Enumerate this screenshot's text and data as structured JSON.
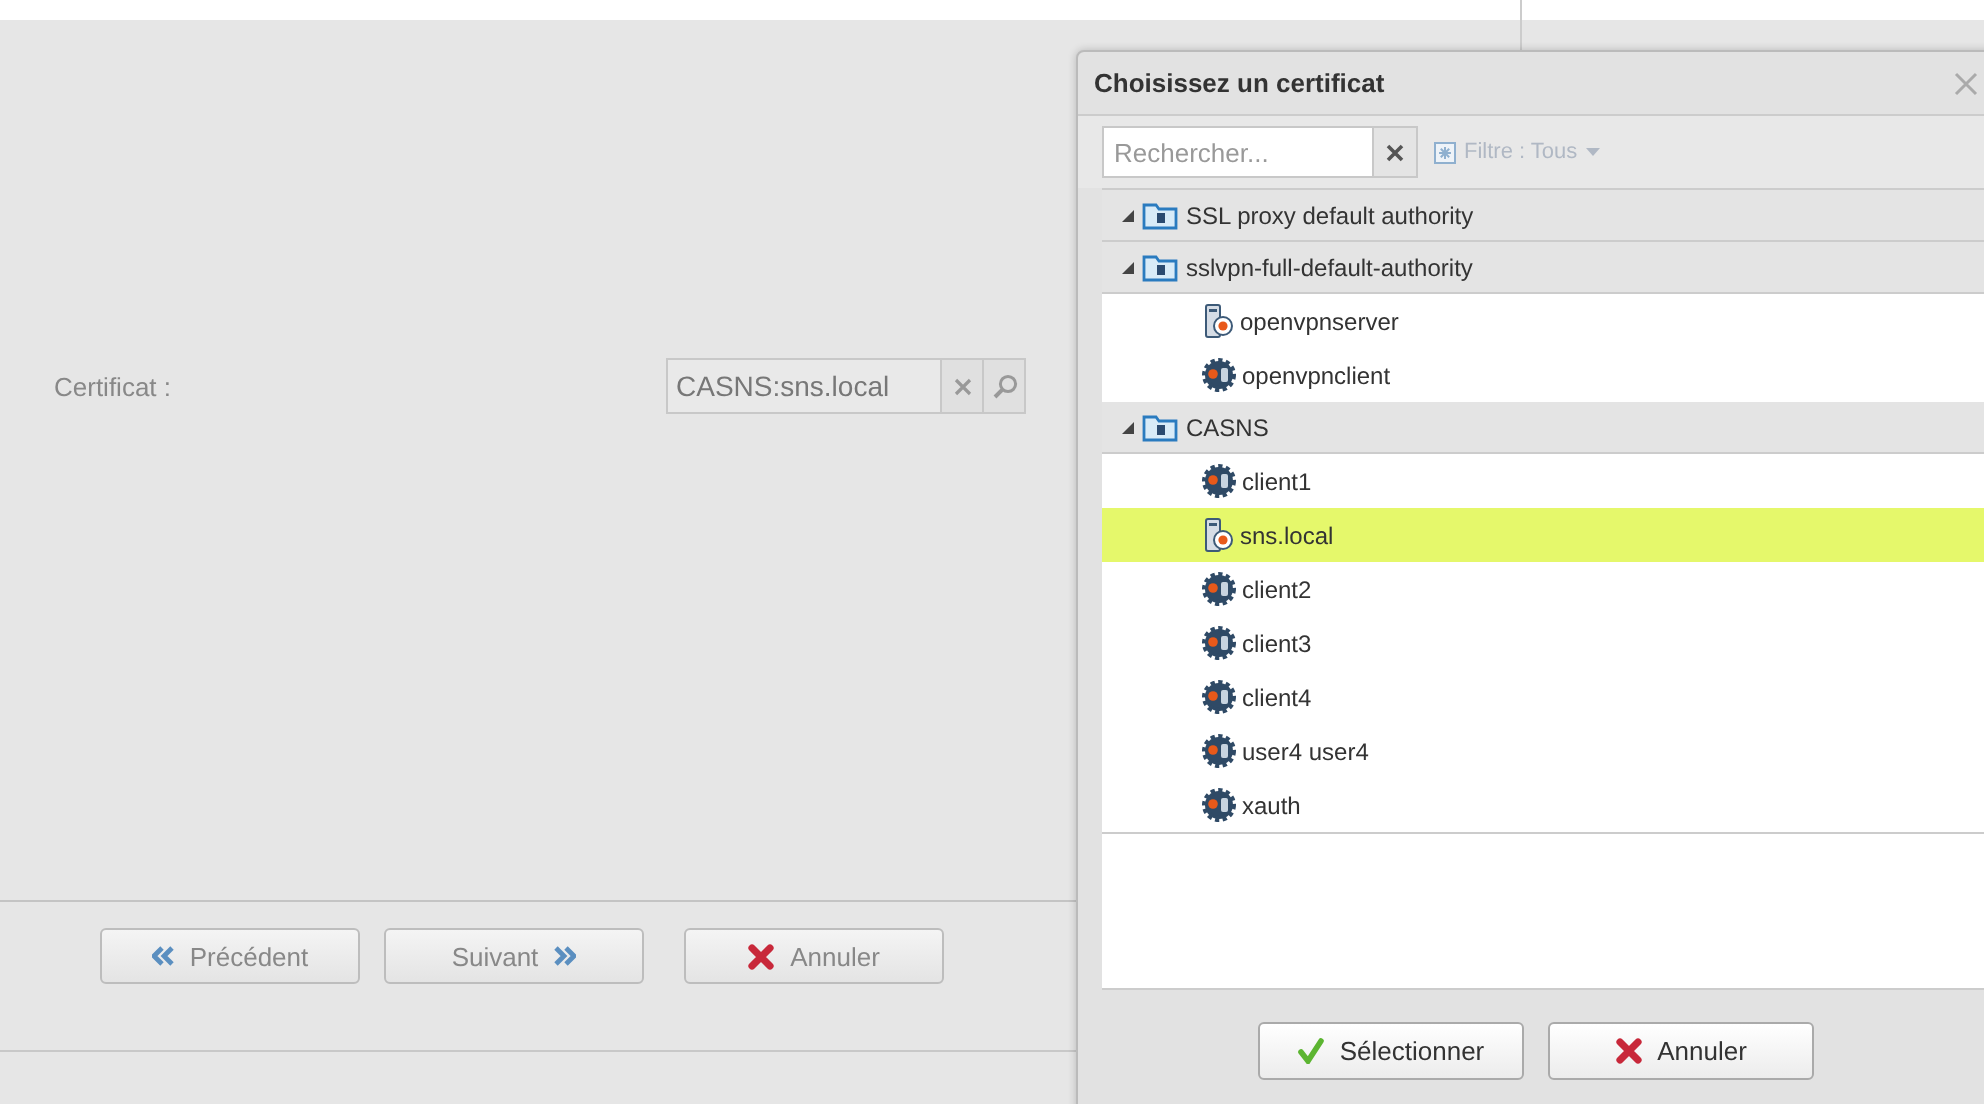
{
  "form": {
    "field_label": "Certificat :",
    "certificate_field": {
      "value": "CASNS:sns.local"
    },
    "buttons": [
      {
        "label": "Précédent",
        "kind": "previous"
      },
      {
        "label": "Suivant",
        "kind": "next"
      },
      {
        "label": "Annuler",
        "kind": "cancel"
      }
    ]
  },
  "dialog": {
    "title": "Choisissez un certificat",
    "search": {
      "placeholder": "Rechercher..."
    },
    "filter": {
      "label": "Filtre : Tous",
      "disabled": true
    },
    "tree": [
      {
        "label": "SSL proxy default authority",
        "expanded": true
      },
      {
        "label": "sslvpn-full-default-authority",
        "expanded": true,
        "children": [
          {
            "label": "openvpnserver",
            "kind": "server",
            "selected": false
          },
          {
            "label": "openvpnclient",
            "kind": "user",
            "selected": false
          }
        ]
      },
      {
        "label": "CASNS",
        "expanded": true,
        "children": [
          {
            "label": "client1",
            "kind": "user",
            "selected": false
          },
          {
            "label": "sns.local",
            "kind": "server",
            "selected": true
          },
          {
            "label": "client2",
            "kind": "user",
            "selected": false
          },
          {
            "label": "client3",
            "kind": "user",
            "selected": false
          },
          {
            "label": "client4",
            "kind": "user",
            "selected": false
          },
          {
            "label": "user4 user4",
            "kind": "user",
            "selected": false
          },
          {
            "label": "xauth",
            "kind": "user",
            "selected": false
          }
        ]
      }
    ],
    "buttons": [
      {
        "label": "Sélectionner",
        "kind": "select"
      },
      {
        "label": "Annuler",
        "kind": "cancel"
      }
    ]
  }
}
